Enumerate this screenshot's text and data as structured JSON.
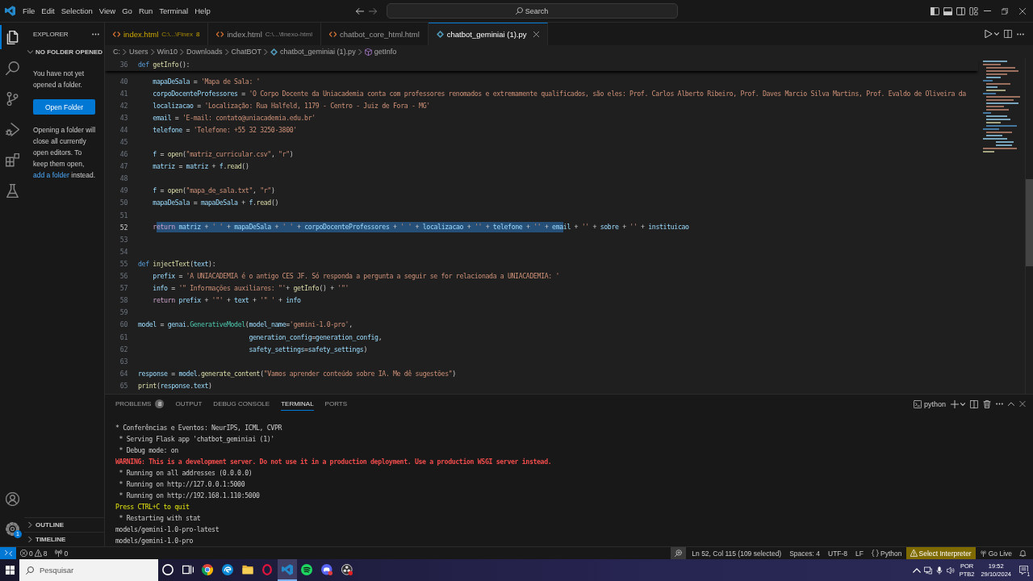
{
  "title_bar": {
    "menu": [
      "File",
      "Edit",
      "Selection",
      "View",
      "Go",
      "Run",
      "Terminal",
      "Help"
    ],
    "command_center": "Search"
  },
  "activity_bar": {
    "items": [
      {
        "kind": "explorer",
        "selected": true
      },
      {
        "kind": "search",
        "selected": false
      },
      {
        "kind": "source-control",
        "selected": false
      },
      {
        "kind": "run",
        "selected": false
      },
      {
        "kind": "extensions",
        "selected": false
      },
      {
        "kind": "testing",
        "selected": false
      }
    ],
    "bottom": [
      {
        "kind": "account"
      },
      {
        "kind": "manage",
        "badge": "1"
      }
    ]
  },
  "sidebar": {
    "title": "EXPLORER",
    "section": {
      "label": "NO FOLDER OPENED",
      "expanded": true
    },
    "message": "You have not yet opened a folder.",
    "button": "Open Folder",
    "hint": {
      "before": "Opening a folder will close all currently open editors. To keep them open,",
      "link": "add a folder",
      "after": "instead."
    },
    "footer_sections": [
      {
        "label": "OUTLINE",
        "expanded": false
      },
      {
        "label": "TIMELINE",
        "expanded": false
      }
    ]
  },
  "editor_tabs": [
    {
      "label": "index.html",
      "path": "C:\\...\\Finex",
      "problems": "8",
      "kind": "html",
      "warning": true,
      "selected": false
    },
    {
      "label": "index.html",
      "path": "C:\\...\\finexo-html",
      "kind": "html",
      "warning": false,
      "selected": false
    },
    {
      "label": "chatbot_core_html.html",
      "kind": "html",
      "warning": false,
      "selected": false
    },
    {
      "label": "chatbot_geminiai (1).py",
      "kind": "python",
      "warning": false,
      "selected": true
    }
  ],
  "breadcrumb": [
    {
      "label": "C:",
      "kind": "folder"
    },
    {
      "label": "Users",
      "kind": "folder"
    },
    {
      "label": "Win10",
      "kind": "folder"
    },
    {
      "label": "Downloads",
      "kind": "folder"
    },
    {
      "label": "ChatBOT",
      "kind": "folder"
    },
    {
      "label": "chatbot_geminiai (1).py",
      "kind": "python"
    },
    {
      "label": "getInfo",
      "kind": "method"
    }
  ],
  "editor": {
    "sticky_line": {
      "n": "36",
      "tokens": [
        {
          "text": "def ",
          "kind": "keyword"
        },
        {
          "text": "getInfo",
          "kind": "function"
        },
        {
          "text": "():",
          "kind": "plain"
        }
      ]
    },
    "lines": [
      {
        "n": "40",
        "current": false,
        "tokens": [
          {
            "text": "    mapaDeSala",
            "kind": "variable"
          },
          {
            "text": " = ",
            "kind": "plain"
          },
          {
            "text": "'Mapa de Sala: '",
            "kind": "string"
          }
        ]
      },
      {
        "n": "41",
        "current": false,
        "tokens": [
          {
            "text": "    corpoDocenteProfessores",
            "kind": "variable"
          },
          {
            "text": " = ",
            "kind": "plain"
          },
          {
            "text": "'O Corpo Docente da Uniacademia conta com professores renomados e extremamente qualificados, são eles: Prof. Carlos Alberto Ribeiro, Prof. Daves Marcio Silva Martins, Prof. Evaldo de Oliveira da",
            "kind": "string"
          }
        ]
      },
      {
        "n": "42",
        "current": false,
        "tokens": [
          {
            "text": "    localizacao",
            "kind": "variable"
          },
          {
            "text": " = ",
            "kind": "plain"
          },
          {
            "text": "'Localização: Rua Halfeld, 1179 - Centro - Juiz de Fora - MG'",
            "kind": "string"
          }
        ]
      },
      {
        "n": "43",
        "current": false,
        "tokens": [
          {
            "text": "    email",
            "kind": "variable"
          },
          {
            "text": " = ",
            "kind": "plain"
          },
          {
            "text": "'E-mail: contato@uniacademia.edu.br'",
            "kind": "string"
          }
        ]
      },
      {
        "n": "44",
        "current": false,
        "tokens": [
          {
            "text": "    telefone",
            "kind": "variable"
          },
          {
            "text": " = ",
            "kind": "plain"
          },
          {
            "text": "'Telefone: +55 32 3250-3800'",
            "kind": "string"
          }
        ]
      },
      {
        "n": "45",
        "current": false
      },
      {
        "n": "46",
        "current": false,
        "tokens": [
          {
            "text": "    f",
            "kind": "variable"
          },
          {
            "text": " = ",
            "kind": "plain"
          },
          {
            "text": "open",
            "kind": "function"
          },
          {
            "text": "(",
            "kind": "plain"
          },
          {
            "text": "\"matriz_curricular.csv\"",
            "kind": "string"
          },
          {
            "text": ", ",
            "kind": "plain"
          },
          {
            "text": "\"r\"",
            "kind": "string"
          },
          {
            "text": ")",
            "kind": "plain"
          }
        ]
      },
      {
        "n": "47",
        "current": false,
        "tokens": [
          {
            "text": "    matriz",
            "kind": "variable"
          },
          {
            "text": " = ",
            "kind": "plain"
          },
          {
            "text": "matriz",
            "kind": "variable"
          },
          {
            "text": " + ",
            "kind": "plain"
          },
          {
            "text": "f",
            "kind": "variable"
          },
          {
            "text": ".",
            "kind": "plain"
          },
          {
            "text": "read",
            "kind": "function"
          },
          {
            "text": "()",
            "kind": "plain"
          }
        ]
      },
      {
        "n": "48",
        "current": false
      },
      {
        "n": "49",
        "current": false,
        "tokens": [
          {
            "text": "    f",
            "kind": "variable"
          },
          {
            "text": " = ",
            "kind": "plain"
          },
          {
            "text": "open",
            "kind": "function"
          },
          {
            "text": "(",
            "kind": "plain"
          },
          {
            "text": "\"mapa_de_sala.txt\"",
            "kind": "string"
          },
          {
            "text": ", ",
            "kind": "plain"
          },
          {
            "text": "\"r\"",
            "kind": "string"
          },
          {
            "text": ")",
            "kind": "plain"
          }
        ]
      },
      {
        "n": "50",
        "current": false,
        "tokens": [
          {
            "text": "    mapaDeSala",
            "kind": "variable"
          },
          {
            "text": " = ",
            "kind": "plain"
          },
          {
            "text": "mapaDeSala",
            "kind": "variable"
          },
          {
            "text": " + ",
            "kind": "plain"
          },
          {
            "text": "f",
            "kind": "variable"
          },
          {
            "text": ".",
            "kind": "plain"
          },
          {
            "text": "read",
            "kind": "function"
          },
          {
            "text": "()",
            "kind": "plain"
          }
        ]
      },
      {
        "n": "51",
        "current": false
      },
      {
        "n": "52",
        "current": true,
        "segments": [
          {
            "selected": false,
            "tokens": [
              {
                "text": "    r",
                "kind": "control"
              }
            ]
          },
          {
            "selected": true,
            "tokens": [
              {
                "text": "eturn ",
                "kind": "control"
              },
              {
                "text": "matriz",
                "kind": "variable"
              },
              {
                "text": " + ",
                "kind": "plain"
              },
              {
                "text": "' '",
                "kind": "string"
              },
              {
                "text": " + ",
                "kind": "plain"
              },
              {
                "text": "mapaDeSala",
                "kind": "variable"
              },
              {
                "text": " + ",
                "kind": "plain"
              },
              {
                "text": "' '",
                "kind": "string"
              },
              {
                "text": " + ",
                "kind": "plain"
              },
              {
                "text": "corpoDocenteProfessores",
                "kind": "variable"
              },
              {
                "text": " + ",
                "kind": "plain"
              },
              {
                "text": "' '",
                "kind": "string"
              },
              {
                "text": " + ",
                "kind": "plain"
              },
              {
                "text": "localizacao",
                "kind": "variable"
              },
              {
                "text": " + ",
                "kind": "plain"
              },
              {
                "text": "''",
                "kind": "string"
              },
              {
                "text": " + ",
                "kind": "plain"
              },
              {
                "text": "telefone",
                "kind": "variable"
              },
              {
                "text": " + ",
                "kind": "plain"
              },
              {
                "text": "''",
                "kind": "string"
              },
              {
                "text": " + ",
                "kind": "plain"
              },
              {
                "text": "ema",
                "kind": "variable"
              }
            ]
          },
          {
            "selected": false,
            "tokens": [
              {
                "text": "il",
                "kind": "variable"
              },
              {
                "text": " + ",
                "kind": "plain"
              },
              {
                "text": "''",
                "kind": "string"
              },
              {
                "text": " + ",
                "kind": "plain"
              },
              {
                "text": "sobre",
                "kind": "variable"
              },
              {
                "text": " + ",
                "kind": "plain"
              },
              {
                "text": "''",
                "kind": "string"
              },
              {
                "text": " + ",
                "kind": "plain"
              },
              {
                "text": "instituicao",
                "kind": "variable"
              }
            ]
          }
        ]
      },
      {
        "n": "53",
        "current": false
      },
      {
        "n": "54",
        "current": false
      },
      {
        "n": "55",
        "current": false,
        "tokens": [
          {
            "text": "def ",
            "kind": "keyword"
          },
          {
            "text": "injectText",
            "kind": "function"
          },
          {
            "text": "(",
            "kind": "plain"
          },
          {
            "text": "text",
            "kind": "variable"
          },
          {
            "text": "):",
            "kind": "plain"
          }
        ]
      },
      {
        "n": "56",
        "current": false,
        "tokens": [
          {
            "text": "    prefix",
            "kind": "variable"
          },
          {
            "text": " = ",
            "kind": "plain"
          },
          {
            "text": "'A UNIACADEMIA é o antigo CES JF. Só responda a pergunta a seguir se for relacionada a UNIACADEMIA: '",
            "kind": "string"
          }
        ]
      },
      {
        "n": "57",
        "current": false,
        "tokens": [
          {
            "text": "    info",
            "kind": "variable"
          },
          {
            "text": " = ",
            "kind": "plain"
          },
          {
            "text": "'\" Informações auxiliares: \"'",
            "kind": "string"
          },
          {
            "text": "+ ",
            "kind": "plain"
          },
          {
            "text": "getInfo",
            "kind": "function"
          },
          {
            "text": "() + ",
            "kind": "plain"
          },
          {
            "text": "'\"'",
            "kind": "string"
          }
        ]
      },
      {
        "n": "58",
        "current": false,
        "tokens": [
          {
            "text": "    return ",
            "kind": "control"
          },
          {
            "text": "prefix",
            "kind": "variable"
          },
          {
            "text": " + ",
            "kind": "plain"
          },
          {
            "text": "'\"'",
            "kind": "string"
          },
          {
            "text": " + ",
            "kind": "plain"
          },
          {
            "text": "text",
            "kind": "variable"
          },
          {
            "text": " + ",
            "kind": "plain"
          },
          {
            "text": "'\" '",
            "kind": "string"
          },
          {
            "text": " + ",
            "kind": "plain"
          },
          {
            "text": "info",
            "kind": "variable"
          }
        ]
      },
      {
        "n": "59",
        "current": false
      },
      {
        "n": "60",
        "current": false,
        "tokens": [
          {
            "text": "model",
            "kind": "variable"
          },
          {
            "text": " = ",
            "kind": "plain"
          },
          {
            "text": "genai",
            "kind": "variable"
          },
          {
            "text": ".",
            "kind": "plain"
          },
          {
            "text": "GenerativeModel",
            "kind": "class"
          },
          {
            "text": "(",
            "kind": "plain"
          },
          {
            "text": "model_name",
            "kind": "variable"
          },
          {
            "text": "=",
            "kind": "plain"
          },
          {
            "text": "'gemini-1.0-pro'",
            "kind": "string"
          },
          {
            "text": ",",
            "kind": "plain"
          }
        ]
      },
      {
        "n": "61",
        "current": false,
        "tokens": [
          {
            "text": "                              generation_config",
            "kind": "variable"
          },
          {
            "text": "=",
            "kind": "plain"
          },
          {
            "text": "generation_config",
            "kind": "variable"
          },
          {
            "text": ",",
            "kind": "plain"
          }
        ]
      },
      {
        "n": "62",
        "current": false,
        "tokens": [
          {
            "text": "                              safety_settings",
            "kind": "variable"
          },
          {
            "text": "=",
            "kind": "plain"
          },
          {
            "text": "safety_settings",
            "kind": "variable"
          },
          {
            "text": ")",
            "kind": "plain"
          }
        ]
      },
      {
        "n": "63",
        "current": false
      },
      {
        "n": "64",
        "current": false,
        "tokens": [
          {
            "text": "response",
            "kind": "variable"
          },
          {
            "text": " = ",
            "kind": "plain"
          },
          {
            "text": "model",
            "kind": "variable"
          },
          {
            "text": ".",
            "kind": "plain"
          },
          {
            "text": "generate_content",
            "kind": "function"
          },
          {
            "text": "(",
            "kind": "plain"
          },
          {
            "text": "\"Vamos aprender conteúdo sobre IA. Me dê sugestões\"",
            "kind": "string"
          },
          {
            "text": ")",
            "kind": "plain"
          }
        ]
      },
      {
        "n": "65",
        "current": false,
        "tokens": [
          {
            "text": "print",
            "kind": "function"
          },
          {
            "text": "(",
            "kind": "plain"
          },
          {
            "text": "response",
            "kind": "variable"
          },
          {
            "text": ".",
            "kind": "plain"
          },
          {
            "text": "text",
            "kind": "variable"
          },
          {
            "text": ")",
            "kind": "plain"
          }
        ]
      }
    ]
  },
  "panel": {
    "tabs": [
      {
        "label": "PROBLEMS",
        "badge": "8",
        "selected": false
      },
      {
        "label": "OUTPUT",
        "selected": false
      },
      {
        "label": "DEBUG CONSOLE",
        "selected": false
      },
      {
        "label": "TERMINAL",
        "selected": true
      },
      {
        "label": "PORTS",
        "selected": false
      }
    ],
    "terminal_name": "python",
    "lines": [
      {
        "text": "* Conferências e Eventos: NeurIPS, ICML, CVPR",
        "kind": "normal"
      },
      {
        "text": " * Serving Flask app 'chatbot_geminiai (1)'",
        "kind": "normal"
      },
      {
        "text": " * Debug mode: on",
        "kind": "normal"
      },
      {
        "text": "WARNING: This is a development server. Do not use it in a production deployment. Use a production WSGI server instead.",
        "kind": "error"
      },
      {
        "text": " * Running on all addresses (0.0.0.0)",
        "kind": "normal"
      },
      {
        "text": " * Running on http://127.0.0.1:5000",
        "kind": "normal"
      },
      {
        "text": " * Running on http://192.168.1.110:5000",
        "kind": "normal"
      },
      {
        "text": "Press CTRL+C to quit",
        "kind": "warning"
      },
      {
        "text": " * Restarting with stat",
        "kind": "normal"
      },
      {
        "text": "models/gemini-1.0-pro-latest",
        "kind": "normal"
      },
      {
        "text": "models/gemini-1.0-pro",
        "kind": "normal"
      }
    ]
  },
  "status_bar": {
    "errors": "0",
    "warnings": "8",
    "ports": "0",
    "cursor": "Ln 52, Col 115 (109 selected)",
    "indentation": "Spaces: 4",
    "encoding": "UTF-8",
    "eol": "LF",
    "language": "Python",
    "interpreter": {
      "label": "Select Interpreter",
      "warning": true
    },
    "live_server": "Go Live"
  },
  "taskbar": {
    "search_placeholder": "Pesquisar",
    "apps": [
      {
        "kind": "circle",
        "active": false
      },
      {
        "kind": "taskview",
        "active": false
      },
      {
        "kind": "tricolor",
        "active": false
      },
      {
        "kind": "wave",
        "active": false
      },
      {
        "kind": "folder",
        "active": false
      },
      {
        "kind": "ring",
        "active": false
      },
      {
        "kind": "ribbon",
        "active": true
      },
      {
        "kind": "waves",
        "active": false
      },
      {
        "kind": "controller",
        "active": false
      },
      {
        "kind": "aperture",
        "active": false
      }
    ],
    "tray": {
      "language": "POR",
      "layout": "PTB2",
      "time": "19:52",
      "date": "29/10/2024",
      "notifications": "1"
    }
  }
}
